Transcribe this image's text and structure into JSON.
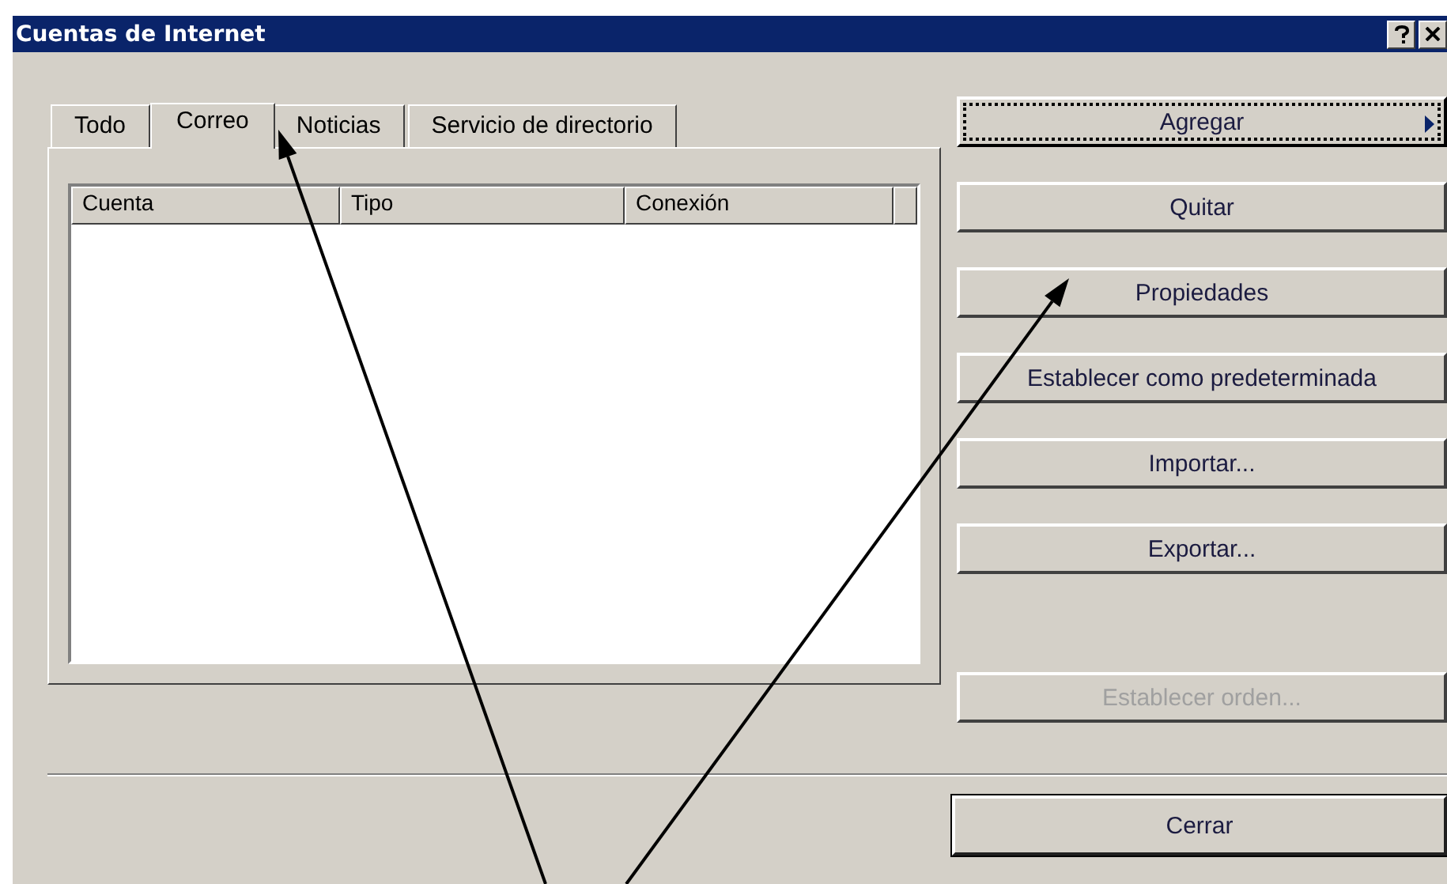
{
  "window": {
    "title": "Cuentas de Internet"
  },
  "tabs": [
    {
      "label": "Todo",
      "selected": false
    },
    {
      "label": "Correo",
      "selected": true
    },
    {
      "label": "Noticias",
      "selected": false
    },
    {
      "label": "Servicio de directorio",
      "selected": false
    }
  ],
  "list": {
    "columns": [
      "Cuenta",
      "Tipo",
      "Conexión"
    ]
  },
  "buttons": [
    {
      "label": "Agregar",
      "kind": "menu",
      "focused": true,
      "disabled": false
    },
    {
      "label": "Quitar",
      "kind": "push",
      "focused": false,
      "disabled": false
    },
    {
      "label": "Propiedades",
      "kind": "push",
      "focused": false,
      "disabled": false
    },
    {
      "label": "Establecer como predeterminada",
      "kind": "push",
      "focused": false,
      "disabled": false
    },
    {
      "label": "Importar...",
      "kind": "push",
      "focused": false,
      "disabled": false
    },
    {
      "label": "Exportar...",
      "kind": "push",
      "focused": false,
      "disabled": false
    },
    {
      "label": "Establecer orden...",
      "kind": "spaced",
      "focused": false,
      "disabled": true
    }
  ],
  "close_button": {
    "label": "Cerrar"
  }
}
